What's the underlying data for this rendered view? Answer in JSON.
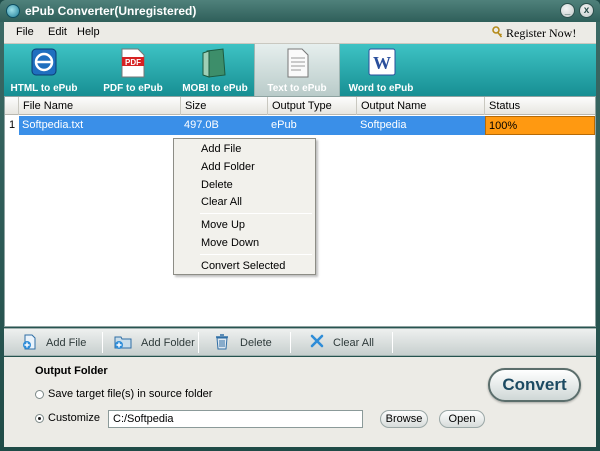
{
  "window": {
    "title": "ePub Converter(Unregistered)",
    "minimize_label": "_",
    "close_label": "x"
  },
  "menu": {
    "items": [
      "File",
      "Edit",
      "Help"
    ],
    "register_label": "Register Now!"
  },
  "toolbar": {
    "buttons": [
      {
        "label": "HTML to ePub",
        "icon": "html-icon"
      },
      {
        "label": "PDF to ePub",
        "icon": "pdf-icon"
      },
      {
        "label": "MOBI to ePub",
        "icon": "mobi-icon"
      },
      {
        "label": "Text to ePub",
        "icon": "text-icon",
        "active": true
      },
      {
        "label": "Word to ePub",
        "icon": "word-icon"
      }
    ]
  },
  "grid": {
    "columns": [
      "File Name",
      "Size",
      "Output Type",
      "Output Name",
      "Status"
    ],
    "rows": [
      {
        "num": "1",
        "file_name": "Softpedia.txt",
        "size": "497.0B",
        "output_type": "ePub",
        "output_name": "Softpedia",
        "status": "100%"
      }
    ]
  },
  "context_menu": {
    "group1": [
      "Add File",
      "Add Folder",
      "Delete",
      "Clear All"
    ],
    "group2": [
      "Move Up",
      "Move Down"
    ],
    "group3": [
      "Convert Selected"
    ]
  },
  "actions": {
    "add_file": "Add File",
    "add_folder": "Add Folder",
    "delete": "Delete",
    "clear_all": "Clear All"
  },
  "output": {
    "label": "Output Folder",
    "option_source": "Save target file(s) in source folder",
    "option_customize": "Customize",
    "path": "C:/Softpedia",
    "browse_label": "Browse",
    "open_label": "Open",
    "selected_option": "customize"
  },
  "convert_label": "Convert",
  "colors": {
    "selection": "#3a8fe8",
    "status_fill": "#ff9911",
    "toolbar": "#2aa9ab"
  }
}
